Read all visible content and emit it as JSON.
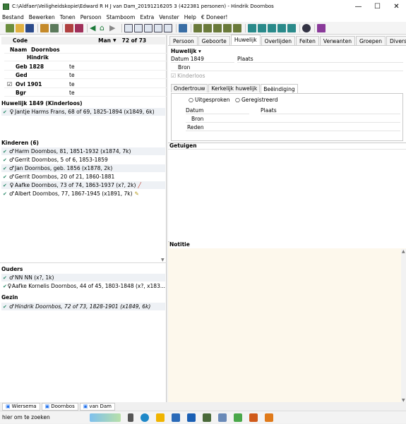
{
  "title_bar": {
    "title": "C:\\Aldfaer\\Veiligheidskopie\\Edward R H J van Dam_20191216205 3 (422381 personen) - Hindrik Doornbos",
    "minimize": "—",
    "maximize": "☐",
    "close": "✕"
  },
  "menu": [
    "Bestand",
    "Bewerken",
    "Tonen",
    "Persoon",
    "Stamboom",
    "Extra",
    "Venster",
    "Help",
    "€ Doneer!"
  ],
  "person": {
    "code_label": "Code",
    "sex": "Man",
    "sex_arrow": "▼",
    "index": "72 of 73",
    "naam_label": "Naam",
    "surname": "Doornbos",
    "firstname": "Hindrik",
    "events": [
      {
        "label": "Geb 1828",
        "te": "te"
      },
      {
        "label": "Ged",
        "te": "te"
      },
      {
        "label": "Ovl 1901",
        "te": "te",
        "checked": true
      },
      {
        "label": "Bgr",
        "te": "te"
      }
    ]
  },
  "marriage": {
    "title": "Huwelijk 1849 (Kinderloos)",
    "partner": "Jantje Harms Frans, 68 of 69, 1825-1894 (x1849, 6k)"
  },
  "children": {
    "title": "Kinderen (6)",
    "items": [
      "Harm Doornbos, 81, 1851-1932 (x1874, 7k)",
      "Gerrit Doornbos, 5 of 6, 1853-1859",
      "Jan Doornbos, geb. 1856 (x1878, 2k)",
      "Gerrit Doornbos, 20 of 21, 1860-1881",
      "Aafke Doornbos, 73 of 74, 1863-1937 (x?, 2k)",
      "Albert Doornbos, 77, 1867-1945 (x1891, 7k)"
    ]
  },
  "parents": {
    "title": "Ouders",
    "items": [
      "NN NN (x?, 1k)",
      "Aafke Kornelis Doornbos, 44 of 45, 1803-1848 (x?, x183..."
    ]
  },
  "family": {
    "title": "Gezin",
    "items": [
      "Hindrik Doornbos, 72 of 73, 1828-1901 (x1849, 6k)"
    ]
  },
  "tabs": [
    "Persoon",
    "Geboorte",
    "Huwelijk",
    "Overlijden",
    "Feiten",
    "Verwanten",
    "Groepen",
    "Diversen"
  ],
  "huwelijk": {
    "header": "Huwelijk ▾",
    "datum": "Datum 1849",
    "plaats": "Plaats",
    "bron": "Bron",
    "kinderloos": "Kinderloos"
  },
  "subtabs": [
    "Ondertrouw",
    "Kerkelijk huwelijk",
    "Beëindiging"
  ],
  "beeindiging": {
    "opt1": "Uitgesproken",
    "opt2": "Geregistreerd",
    "datum": "Datum",
    "plaats": "Plaats",
    "bron": "Bron",
    "reden": "Reden"
  },
  "getuigen": "Getuigen",
  "notitie": "Notitie",
  "bottom_tabs": [
    "Wiersema",
    "Doornbos",
    "van Dam"
  ],
  "taskbar": {
    "search": "hier om te zoeken"
  },
  "colors": {
    "accent": "#1f6feb",
    "note_bg": "#fdf8ec"
  }
}
